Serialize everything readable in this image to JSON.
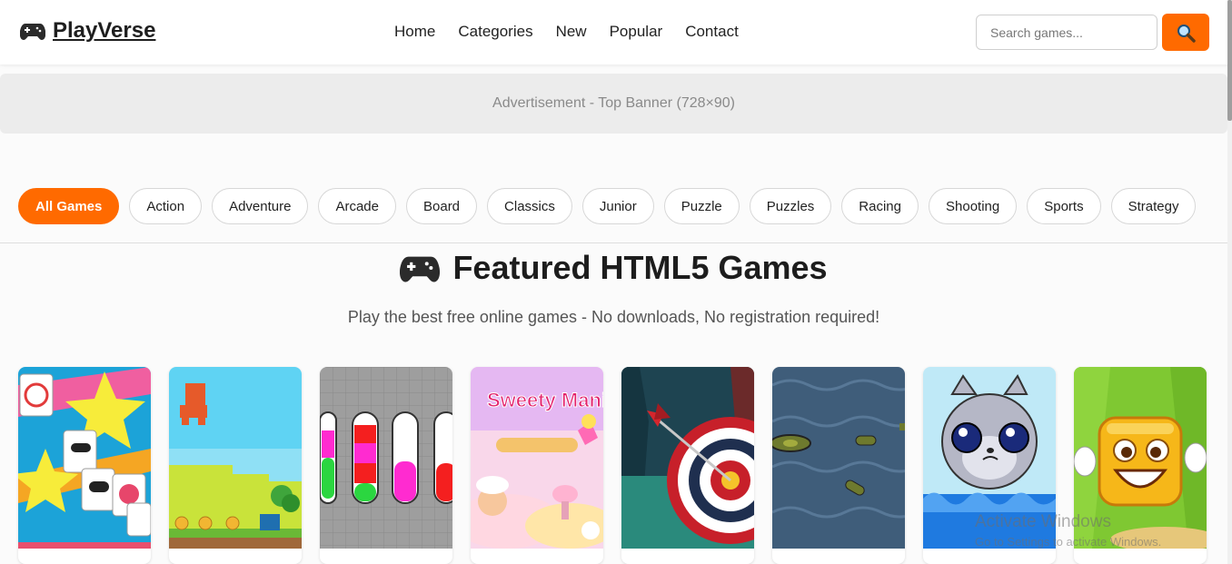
{
  "header": {
    "logo_text": "PlayVerse",
    "nav": [
      "Home",
      "Categories",
      "New",
      "Popular",
      "Contact"
    ],
    "search_placeholder": "Search games..."
  },
  "ad": {
    "text": "Advertisement - Top Banner (728×90)"
  },
  "categories": [
    "All Games",
    "Action",
    "Adventure",
    "Arcade",
    "Board",
    "Classics",
    "Junior",
    "Puzzle",
    "Puzzles",
    "Racing",
    "Shooting",
    "Sports",
    "Strategy"
  ],
  "active_category": "All Games",
  "featured": {
    "title": "Featured HTML5 Games",
    "subtitle": "Play the best free online games - No downloads, No registration required!"
  },
  "games": [
    {
      "icon": "mahjong-candy-thumbnail"
    },
    {
      "icon": "pixel-platformer-thumbnail"
    },
    {
      "icon": "water-sort-thumbnail"
    },
    {
      "icon": "sweety-mania-thumbnail",
      "logo_text": "Sweety Mania"
    },
    {
      "icon": "archery-target-thumbnail"
    },
    {
      "icon": "submarine-sea-thumbnail"
    },
    {
      "icon": "pixel-cat-water-thumbnail"
    },
    {
      "icon": "smiling-cube-thumbnail"
    }
  ],
  "system_watermark": {
    "title": "Activate Windows",
    "subtitle": "Go to Settings to activate Windows."
  },
  "colors": {
    "accent": "#ff6a00",
    "ad_background": "#ececec",
    "page_background": "#fbfbfb"
  }
}
